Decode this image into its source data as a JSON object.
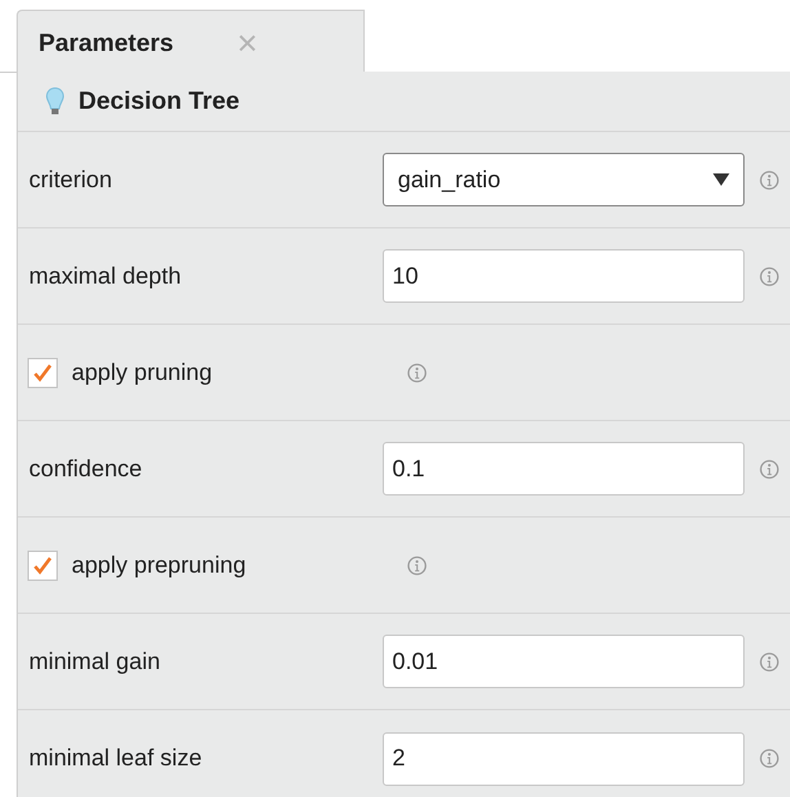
{
  "tab": {
    "title": "Parameters",
    "close": "×"
  },
  "operator": {
    "name": "Decision Tree"
  },
  "parameters": [
    {
      "kind": "dropdown",
      "label": "criterion",
      "value": "gain_ratio"
    },
    {
      "kind": "number",
      "label": "maximal depth",
      "value": "10"
    },
    {
      "kind": "checkbox",
      "label": "apply pruning",
      "checked": true
    },
    {
      "kind": "number",
      "label": "confidence",
      "value": "0.1"
    },
    {
      "kind": "checkbox",
      "label": "apply prepruning",
      "checked": true
    },
    {
      "kind": "number",
      "label": "minimal gain",
      "value": "0.01"
    },
    {
      "kind": "number",
      "label": "minimal leaf size",
      "value": "2"
    }
  ]
}
